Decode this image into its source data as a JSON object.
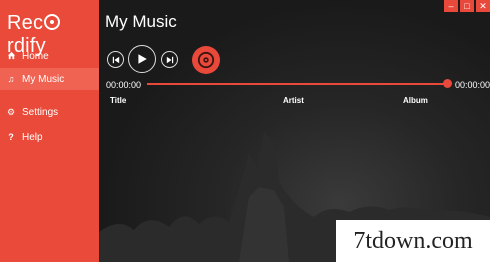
{
  "app": {
    "name_pre": "Rec",
    "name_post": "rdify"
  },
  "sidebar": {
    "items": [
      {
        "label": "Home",
        "icon": "home-icon"
      },
      {
        "label": "My Music",
        "icon": "music-note-icon"
      },
      {
        "label": "Settings",
        "icon": "gear-icon"
      },
      {
        "label": "Help",
        "icon": "help-icon"
      }
    ]
  },
  "main": {
    "title": "My Music",
    "player": {
      "time_start": "00:00:00",
      "time_end": "00:00:00",
      "progress": 1.0
    },
    "columns": [
      "Title",
      "Artist",
      "Album"
    ]
  },
  "window": {
    "minimize": "–",
    "maximize": "□",
    "close": "✕"
  },
  "watermark": "7tdown.com",
  "colors": {
    "accent": "#ea4a39",
    "background": "#1a1a1a"
  }
}
